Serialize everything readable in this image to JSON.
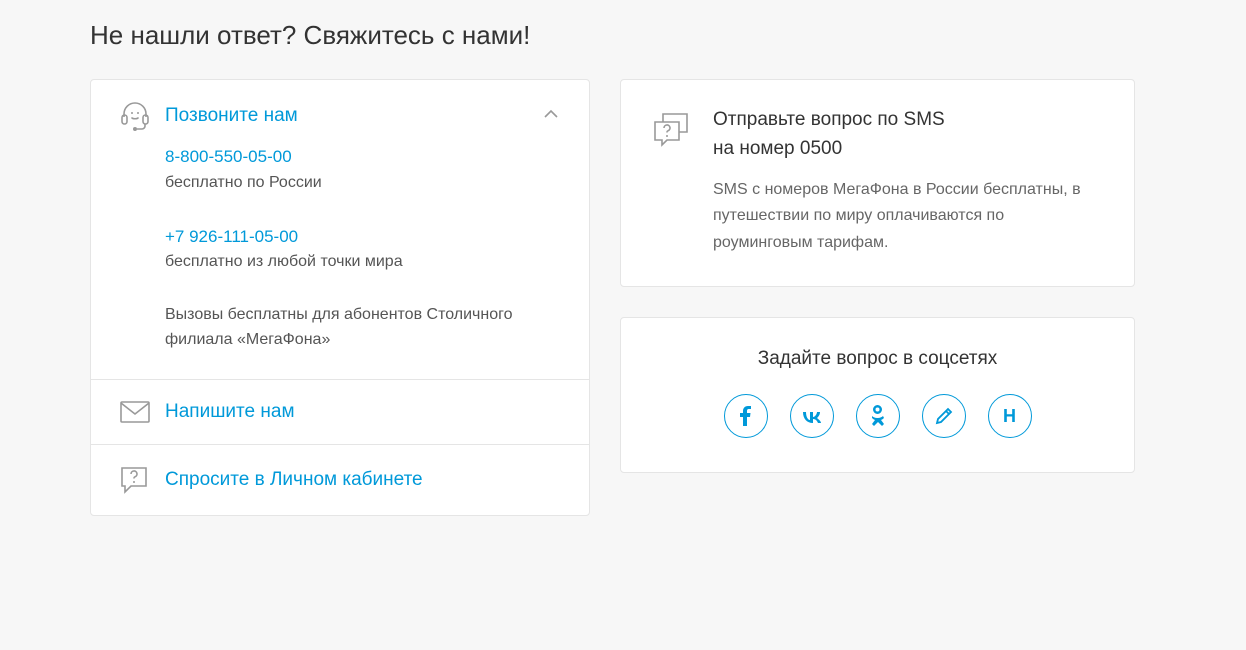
{
  "heading": "Не нашли ответ? Свяжитесь с нами!",
  "call": {
    "title": "Позвоните нам",
    "phone1": "8-800-550-05-00",
    "phone1_desc": "бесплатно по России",
    "phone2": "+7 926-111-05-00",
    "phone2_desc": "бесплатно из любой точки мира",
    "note": "Вызовы бесплатны для абонентов Столичного филиала «МегаФона»"
  },
  "write": {
    "title": "Напишите нам"
  },
  "ask": {
    "title": "Спросите в Личном кабинете"
  },
  "sms": {
    "title_line1": "Отправьте вопрос по SMS",
    "title_line2": "на номер 0500",
    "desc": "SMS с номеров МегаФона в России бесплатны, в путешествии по миру оплачиваются по роуминговым тарифам."
  },
  "social": {
    "title": "Задайте вопрос в соцсетях",
    "items": [
      "facebook",
      "vk",
      "ok",
      "pencil",
      "habr"
    ]
  }
}
